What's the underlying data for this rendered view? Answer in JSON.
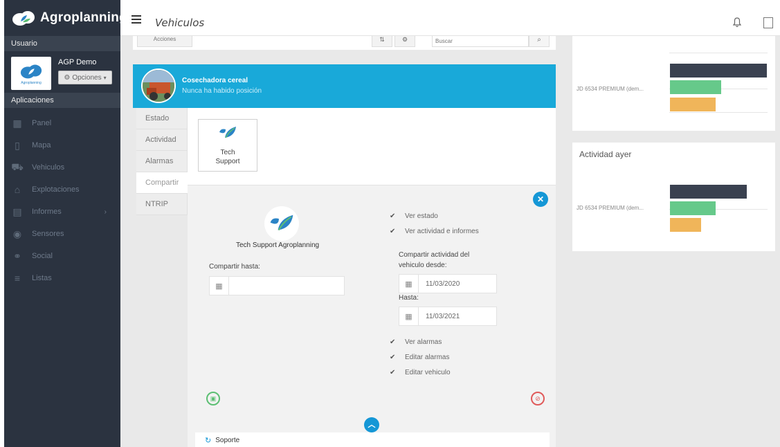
{
  "app": {
    "brand": "Agroplanning",
    "page_title": "Vehiculos"
  },
  "sidebar": {
    "user_section": "Usuario",
    "user_name": "AGP Demo",
    "avatar_caption": "Agroplanning",
    "options_label": "Opciones",
    "apps_section": "Aplicaciones",
    "items": [
      {
        "label": "Panel",
        "icon": "panel-icon"
      },
      {
        "label": "Mapa",
        "icon": "map-icon"
      },
      {
        "label": "Vehiculos",
        "icon": "vehicle-icon"
      },
      {
        "label": "Explotaciones",
        "icon": "farm-icon"
      },
      {
        "label": "Informes",
        "icon": "report-icon"
      },
      {
        "label": "Sensores",
        "icon": "sensor-icon"
      },
      {
        "label": "Social",
        "icon": "social-icon"
      },
      {
        "label": "Listas",
        "icon": "list-icon"
      }
    ]
  },
  "toolbar": {
    "acciones_label": "Acciones",
    "search_placeholder": "Buscar"
  },
  "vehicle": {
    "name": "Cosechadora cereal",
    "position_status": "Nunca ha habido posición"
  },
  "tabs": [
    "Estado",
    "Actividad",
    "Alarmas",
    "Compartir",
    "NTRIP"
  ],
  "active_tab": "Compartir",
  "share": {
    "tile_line1": "Tech",
    "tile_line2": "Support",
    "org_name": "Tech Support Agroplanning",
    "until_label": "Compartir hasta:",
    "until_value": "",
    "share_from_label": "Compartir actividad del vehiculo desde:",
    "from_date": "11/03/2020",
    "hasta_label": "Hasta:",
    "to_date": "11/03/2021",
    "checks_top": [
      {
        "label": "Ver estado",
        "checked": true
      },
      {
        "label": "Ver actividad e informes",
        "checked": true
      }
    ],
    "checks_bottom": [
      {
        "label": "Ver alarmas",
        "checked": true
      },
      {
        "label": "Editar alarmas",
        "checked": true
      },
      {
        "label": "Editar vehiculo",
        "checked": true
      }
    ],
    "soporte_label": "Soporte"
  },
  "right_panels": {
    "activity_yesterday_title": "Actividad ayer",
    "vehicle_label": "JD 6534 PREMIUM (dem...",
    "colors": {
      "dark": "#3a4150",
      "green": "#66c98a",
      "orange": "#f0b55a"
    },
    "chart_top": [
      1.0,
      0.53,
      0.47
    ],
    "chart_bottom": [
      0.79,
      0.47,
      0.32
    ]
  }
}
